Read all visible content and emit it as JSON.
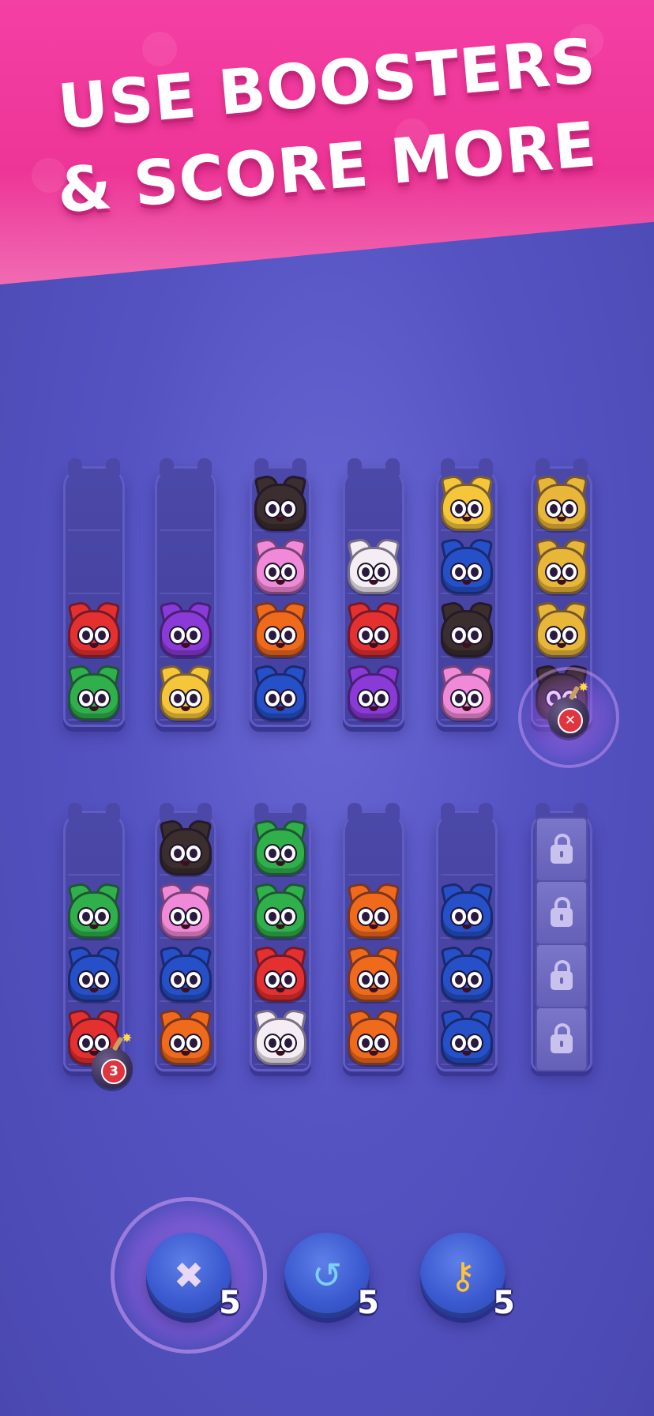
{
  "banner": {
    "line1": "USE BOOSTERS",
    "line2": "& SCORE MORE"
  },
  "colors": {
    "banner_pink": "#f03a9c",
    "background": "#5553c2",
    "green": "#2fb04a",
    "red": "#e53030",
    "purple": "#8a3ad6",
    "yellow": "#f5c63a",
    "black": "#3a2e2e",
    "pink": "#f08ad8",
    "orange": "#f06a1c",
    "blue": "#2550c8",
    "white": "#f4eef4",
    "gold": "#e8b638"
  },
  "board": {
    "top_row": [
      {
        "cats": [
          "red",
          "green"
        ]
      },
      {
        "cats": [
          "purple",
          "yellow"
        ]
      },
      {
        "cats": [
          "black",
          "pink",
          "orange",
          "blue"
        ]
      },
      {
        "cats": [
          "white",
          "red",
          "purple"
        ]
      },
      {
        "cats": [
          "yellow",
          "blue",
          "black",
          "pink"
        ]
      },
      {
        "cats": [
          "gold",
          "gold",
          "gold",
          "black"
        ],
        "bomb_icon": "bomb-cancel-icon"
      }
    ],
    "bottom_row": [
      {
        "cats": [
          "green",
          "blue",
          "red"
        ],
        "bomb_counter": "3"
      },
      {
        "cats": [
          "black",
          "pink",
          "blue",
          "orange"
        ]
      },
      {
        "cats": [
          "green",
          "green",
          "red",
          "white"
        ]
      },
      {
        "cats": [
          "orange",
          "orange",
          "orange"
        ]
      },
      {
        "cats": [
          "blue",
          "blue",
          "blue"
        ]
      },
      {
        "locked": true,
        "lock_icon": "padlock-icon"
      }
    ]
  },
  "boosters": [
    {
      "name": "bomb-booster",
      "icon": "bomb-icon",
      "count": "5",
      "active": true
    },
    {
      "name": "undo-booster",
      "icon": "undo-arrow-icon",
      "count": "5",
      "active": false
    },
    {
      "name": "key-booster",
      "icon": "key-icon",
      "count": "5",
      "active": false
    }
  ]
}
